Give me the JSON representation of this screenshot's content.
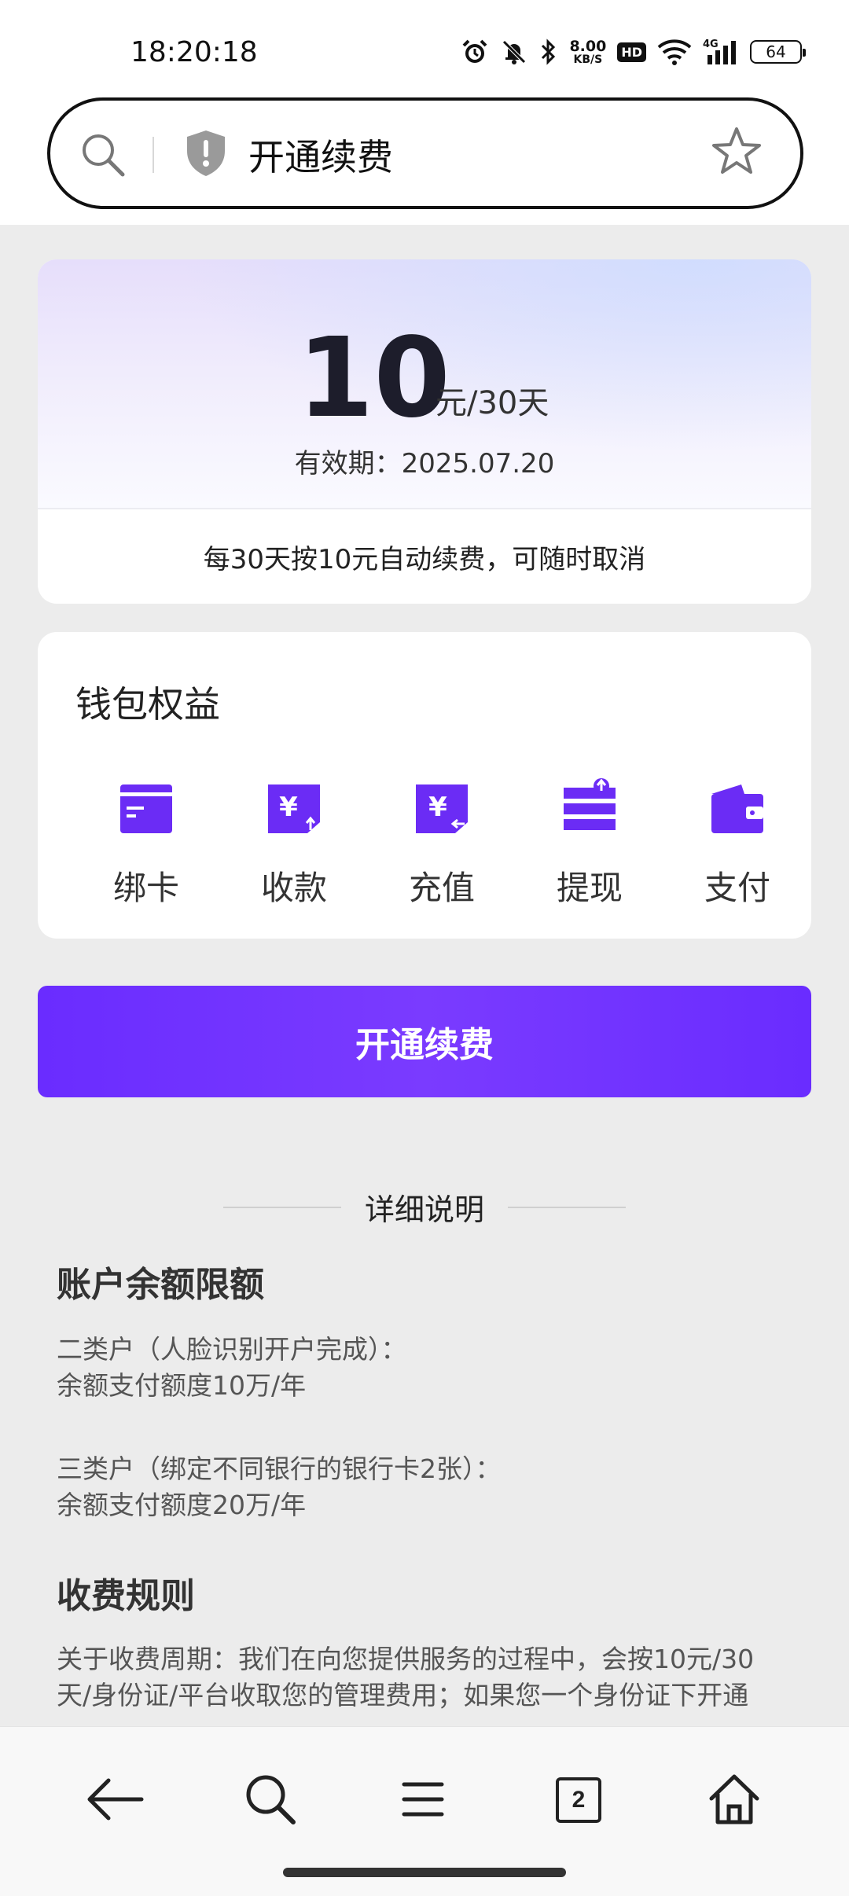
{
  "status_bar": {
    "time": "18:20:18",
    "net_speed_value": "8.00",
    "net_speed_unit": "KB/S",
    "hd_badge": "HD",
    "signal_label": "4G",
    "battery": "64",
    "icons": [
      "alarm-icon",
      "mute-bell-icon",
      "bluetooth-icon",
      "wifi-icon",
      "cell-signal-icon",
      "battery-icon"
    ]
  },
  "address_bar": {
    "title": "开通续费",
    "icons": [
      "search-icon",
      "shield-warning-icon",
      "star-icon"
    ]
  },
  "price_card": {
    "amount": "10",
    "unit": "元/30天",
    "validity": "有效期：2025.07.20",
    "renew_note": "每30天按10元自动续费，可随时取消"
  },
  "wallet": {
    "title": "钱包权益",
    "benefits": [
      {
        "label": "绑卡",
        "icon": "bind-card-icon"
      },
      {
        "label": "收款",
        "icon": "receive-money-icon"
      },
      {
        "label": "充值",
        "icon": "recharge-icon"
      },
      {
        "label": "提现",
        "icon": "withdraw-icon"
      },
      {
        "label": "支付",
        "icon": "wallet-pay-icon"
      }
    ]
  },
  "cta": {
    "label": "开通续费"
  },
  "details": {
    "header": "详细说明",
    "balance_title": "账户余额限额",
    "tier2_line1": "二类户（人脸识别开户完成）：",
    "tier2_line2": "余额支付额度10万/年",
    "tier3_line1": "三类户（绑定不同银行的银行卡2张）：",
    "tier3_line2": "余额支付额度20万/年",
    "fee_title": "收费规则",
    "fee_line1": "关于收费周期：我们在向您提供服务的过程中，会按10元/30",
    "fee_line2": "天/身份证/平台收取您的管理费用；如果您一个身份证下开通"
  },
  "bottom_nav": {
    "tab_count": "2",
    "icons": [
      "back-arrow-icon",
      "search-icon",
      "menu-icon",
      "tabs-icon",
      "home-icon"
    ]
  },
  "colors": {
    "accent": "#6a2cff",
    "icon_purple": "#6b2cf5",
    "background": "#ececec"
  }
}
